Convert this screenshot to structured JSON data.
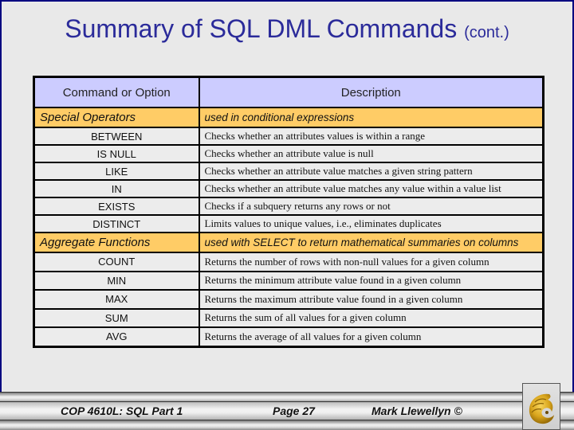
{
  "slide": {
    "title": "Summary of SQL DML Commands",
    "title_suffix": "(cont.)"
  },
  "table": {
    "headers": [
      "Command or Option",
      "Description"
    ],
    "sections": [
      {
        "name": "Special Operators",
        "description": "used in conditional expressions",
        "rows": [
          {
            "command": "BETWEEN",
            "description": "Checks whether an attributes values is within a range"
          },
          {
            "command": "IS NULL",
            "description": "Checks whether an attribute value is null"
          },
          {
            "command": "LIKE",
            "description": "Checks whether an attribute value matches a given string pattern"
          },
          {
            "command": "IN",
            "description": "Checks whether an attribute value matches any value within a value list"
          },
          {
            "command": "EXISTS",
            "description": "Checks if a subquery returns any rows or not"
          },
          {
            "command": "DISTINCT",
            "description": "Limits values to unique values, i.e., eliminates duplicates"
          }
        ]
      },
      {
        "name": "Aggregate Functions",
        "description": "used with SELECT to return mathematical summaries on columns",
        "rows": [
          {
            "command": "COUNT",
            "description": "Returns the number of rows with non-null values for a given column"
          },
          {
            "command": "MIN",
            "description": "Returns the minimum attribute value found in a given column"
          },
          {
            "command": "MAX",
            "description": "Returns the maximum attribute value found in a given column"
          },
          {
            "command": "SUM",
            "description": "Returns the sum of all values for a given column"
          },
          {
            "command": "AVG",
            "description": "Returns the average of all values for a given column"
          }
        ]
      }
    ]
  },
  "footer": {
    "course": "COP 4610L: SQL Part 1",
    "page": "Page 27",
    "author": "Mark Llewellyn ©",
    "logo_icon": "pegasus-logo-icon"
  },
  "colors": {
    "title": "#2b2b9a",
    "header_bg": "#ccccff",
    "section_bg": "#ffcc66",
    "row_bg": "#ececec",
    "frame_border": "#000080"
  }
}
